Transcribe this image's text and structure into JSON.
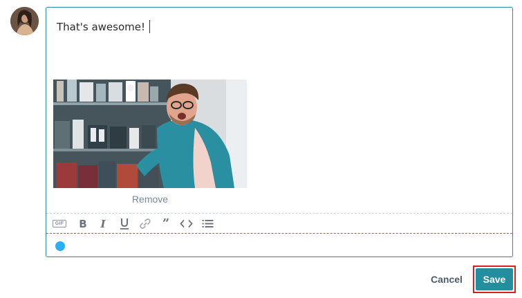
{
  "comment": {
    "text": "That's awesome!"
  },
  "attachment": {
    "remove_label": "Remove"
  },
  "toolbar": {
    "gif_label": "GIF",
    "bold_label": "B",
    "italic_label": "I",
    "quote_label": "”"
  },
  "actions": {
    "cancel_label": "Cancel",
    "save_label": "Save"
  },
  "colors": {
    "accent": "#238e9e",
    "editor_border": "#2a8a9a",
    "status_dot": "#29b1f2",
    "highlight_border": "#d81f1f"
  }
}
